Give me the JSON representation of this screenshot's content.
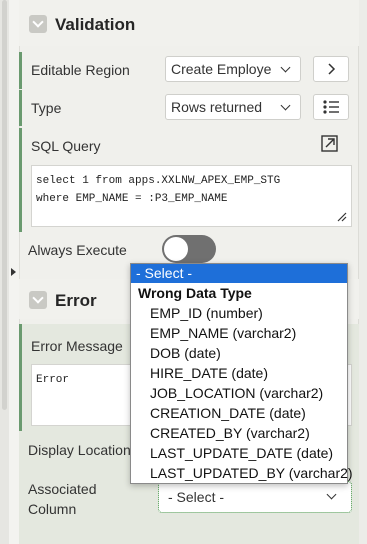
{
  "validation": {
    "title": "Validation",
    "editable_region": {
      "label": "Editable Region",
      "value": "Create Employe"
    },
    "type": {
      "label": "Type",
      "value": "Rows returned"
    },
    "sql_query": {
      "label": "SQL Query",
      "line1": "select 1 from apps.XXLNW_APEX_EMP_STG",
      "line2": "where EMP_NAME = :P3_EMP_NAME"
    },
    "always_execute": {
      "label": "Always Execute",
      "on": false
    }
  },
  "error": {
    "title": "Error",
    "error_message": {
      "label": "Error Message",
      "value": "Error"
    },
    "display_location": {
      "label": "Display Location"
    },
    "associated_column": {
      "label_line1": "Associated",
      "label_line2": "Column",
      "value": "- Select -"
    }
  },
  "dropdown": {
    "selected": "- Select -",
    "group": "Wrong Data Type",
    "options": [
      "EMP_ID (number)",
      "EMP_NAME (varchar2)",
      "DOB (date)",
      "HIRE_DATE (date)",
      "JOB_LOCATION (varchar2)",
      "CREATION_DATE (date)",
      "CREATED_BY (varchar2)",
      "LAST_UPDATE_DATE (date)",
      "LAST_UPDATED_BY (varchar2)"
    ]
  },
  "colors": {
    "accent_green": "#6a9a6f",
    "selected_blue": "#1e6fd9",
    "toggle_off": "#707070"
  },
  "icons": [
    "chevron-down-icon",
    "chevron-right-icon",
    "list-icon",
    "expand-icon",
    "resize-grip-icon",
    "collapse-arrow-icon"
  ]
}
